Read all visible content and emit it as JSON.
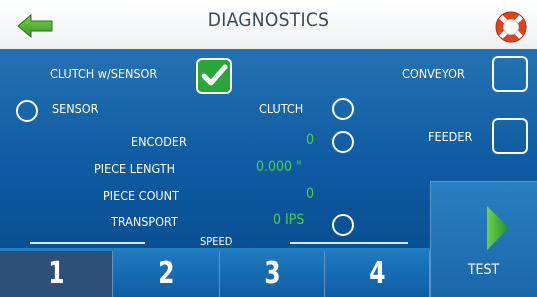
{
  "header": {
    "title": "DIAGNOSTICS",
    "back_icon": "back-arrow-icon",
    "help_icon": "lifebuoy-icon"
  },
  "options": {
    "clutch_with_sensor": {
      "label": "CLUTCH w/SENSOR",
      "checked": true
    },
    "conveyor": {
      "label": "CONVEYOR",
      "checked": false
    },
    "feeder": {
      "label": "FEEDER",
      "checked": false
    },
    "sensor": {
      "label": "SENSOR",
      "selected": false
    },
    "clutch": {
      "label": "CLUTCH",
      "selected": false
    }
  },
  "readouts": {
    "encoder": {
      "label": "ENCODER",
      "value": "0"
    },
    "piece_length": {
      "label": "PIECE LENGTH",
      "value": "0.000 \""
    },
    "piece_count": {
      "label": "PIECE COUNT",
      "value": "0"
    },
    "transport": {
      "label": "TRANSPORT",
      "value": "0 IPS"
    }
  },
  "speed": {
    "label": "SPEED",
    "tabs": [
      "1",
      "2",
      "3",
      "4"
    ],
    "selected": "1"
  },
  "test": {
    "label": "TEST"
  },
  "colors": {
    "panel_blue": "#1568ad",
    "value_green": "#4fd13c",
    "check_green": "#2aa53a",
    "selected_tab": "#2e4f78"
  }
}
